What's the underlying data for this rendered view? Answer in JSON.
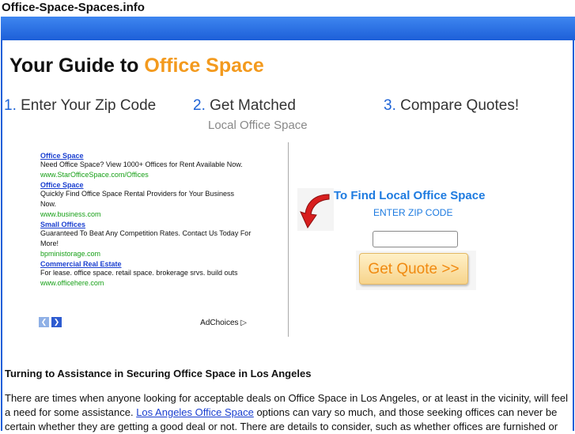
{
  "site": {
    "title": "Office-Space-Spaces.info"
  },
  "hero": {
    "prefix": "Your Guide to ",
    "accent": "Office Space"
  },
  "steps": [
    {
      "num": "1.",
      "label": " Enter Your Zip Code"
    },
    {
      "num": "2.",
      "label": " Get Matched",
      "sub": "Local Office Space"
    },
    {
      "num": "3.",
      "label": " Compare Quotes!"
    }
  ],
  "ads": [
    {
      "title": "Office Space",
      "desc": "Need Office Space? View 1000+ Offices for Rent Available Now.",
      "url": "www.StarOfficeSpace.com/Offices"
    },
    {
      "title": "Office Space",
      "desc": "Quickly Find Office Space Rental Providers for Your Business Now.",
      "url": "www.business.com"
    },
    {
      "title": "Small Offices",
      "desc": "Guaranteed To Beat Any Competition Rates. Contact Us Today For More!",
      "url": "bpministorage.com"
    },
    {
      "title": "Commercial Real Estate",
      "desc": "For lease. office space. retail space. brokerage srvs. build outs",
      "url": "www.officehere.com"
    }
  ],
  "adchoices": "AdChoices ▷",
  "finder": {
    "title": "To Find Local Office Space",
    "zip_label": "ENTER ZIP CODE",
    "zip_value": "",
    "button": "Get Quote >>"
  },
  "article": {
    "title": "Turning to Assistance in Securing Office Space in Los Angeles",
    "p1": "There are times when anyone looking for acceptable deals on Office Space in Los Angeles, or at least in the vicinity, will feel a need for some assistance. ",
    "link": "Los Angeles Office Space",
    "p2": " options can vary so much, and those seeking offices can never be certain whether they are getting a good deal or not. There are details to consider, such as whether offices are furnished or"
  }
}
